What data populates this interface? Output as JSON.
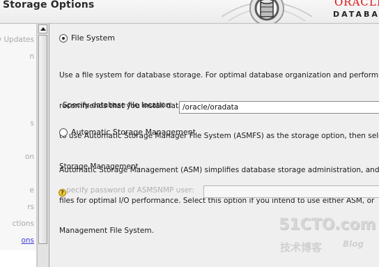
{
  "header": {
    "title": "Storage Options",
    "brand_oracle": "ORACLE",
    "brand_database": "DATABA"
  },
  "nav": {
    "items": [
      {
        "label": "y Updates",
        "active": false
      },
      {
        "label": "n",
        "active": false
      },
      {
        "label": "s",
        "active": false
      },
      {
        "label": "on",
        "active": false
      },
      {
        "label": "e",
        "active": false
      },
      {
        "label": "rs",
        "active": false
      },
      {
        "label": "ctions",
        "active": false
      },
      {
        "label": "ons",
        "active": true
      }
    ]
  },
  "main": {
    "file_system": {
      "label": "File System",
      "selected": true,
      "description": [
        "Use a file system for database storage. For optimal database organization and perform",
        "recommends that you install data files and the Oracle database software on different d",
        "to use Automatic Storage Manager File System (ASMFS) as the storage option, then sele",
        "Storage Management."
      ],
      "location_label": "Specify database file location:",
      "location_value": "/oracle/oradata"
    },
    "asm": {
      "label": "Automatic Storage Management",
      "selected": false,
      "description": [
        "Automatic Storage Management (ASM) simplifies database storage administration, and",
        "files for optimal I/O performance. Select this option if you intend to use either ASM, or",
        "Management File System."
      ],
      "password_label": "pecify password of ASMSNMP user:",
      "password_value": ""
    }
  },
  "watermark": {
    "line1": "51CTO.com",
    "line2_cn": "技术博客",
    "line2_blog": "Blog"
  },
  "colors": {
    "brand_red": "#d11111",
    "nav_active": "#3d3dd6",
    "disabled_text": "#b0b0b0"
  }
}
